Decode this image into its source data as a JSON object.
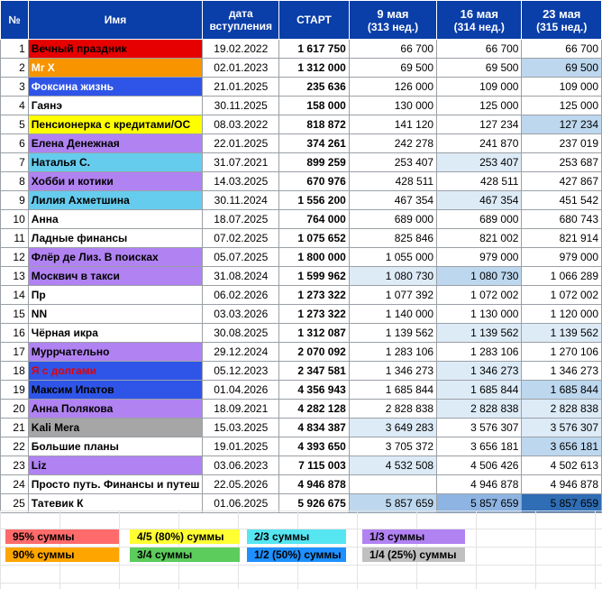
{
  "headers": {
    "idx": "№",
    "name": "Имя",
    "date": [
      "дата",
      "вступления"
    ],
    "start": "СТАРТ",
    "w1": [
      "9 мая",
      "(313 нед.)"
    ],
    "w2": [
      "16 мая",
      "(314 нед.)"
    ],
    "w3": [
      "23 мая",
      "(315 нед.)"
    ]
  },
  "rows": [
    {
      "n": "1",
      "name": "Вечный праздник",
      "date": "19.02.2022",
      "start": "1 617 750",
      "w1": "66 700",
      "w2": "66 700",
      "w3": "66 700",
      "name_bg": "#e60000",
      "name_color": "#000000",
      "w1_bg": "",
      "w2_bg": "",
      "w3_bg": ""
    },
    {
      "n": "2",
      "name": "Mr X",
      "date": "02.01.2023",
      "start": "1 312 000",
      "w1": "69 500",
      "w2": "69 500",
      "w3": "69 500",
      "name_bg": "#f79400",
      "name_color": "#ffffff",
      "w1_bg": "",
      "w2_bg": "",
      "w3_bg": "#bdd7ee"
    },
    {
      "n": "3",
      "name": "Фоксина жизнь",
      "date": "21.01.2025",
      "start": "235 636",
      "w1": "126 000",
      "w2": "109 000",
      "w3": "109 000",
      "name_bg": "#2f55e8",
      "name_color": "#ffffff",
      "w1_bg": "",
      "w2_bg": "",
      "w3_bg": ""
    },
    {
      "n": "4",
      "name": "Гаянэ",
      "date": "30.11.2025",
      "start": "158 000",
      "w1": "130 000",
      "w2": "125 000",
      "w3": "125 000",
      "name_bg": "",
      "name_color": "#000000",
      "w1_bg": "",
      "w2_bg": "",
      "w3_bg": ""
    },
    {
      "n": "5",
      "name": "Пенсионерка с кредитами/ОС",
      "date": "08.03.2022",
      "start": "818 872",
      "w1": "141 120",
      "w2": "127 234",
      "w3": "127 234",
      "name_bg": "#ffff00",
      "name_color": "#000000",
      "w1_bg": "",
      "w2_bg": "",
      "w3_bg": "#bdd7ee"
    },
    {
      "n": "6",
      "name": "Елена Денежная",
      "date": "22.01.2025",
      "start": "374 261",
      "w1": "242 278",
      "w2": "241 870",
      "w3": "237 019",
      "name_bg": "#b182f2",
      "name_color": "#000000",
      "w1_bg": "",
      "w2_bg": "",
      "w3_bg": ""
    },
    {
      "n": "7",
      "name": "Наталья С.",
      "date": "31.07.2021",
      "start": "899 259",
      "w1": "253 407",
      "w2": "253 407",
      "w3": "253 687",
      "name_bg": "#66ccee",
      "name_color": "#000000",
      "w1_bg": "",
      "w2_bg": "#ddebf7",
      "w3_bg": ""
    },
    {
      "n": "8",
      "name": "Хобби и котики",
      "date": "14.03.2025",
      "start": "670 976",
      "w1": "428 511",
      "w2": "428 511",
      "w3": "427 867",
      "name_bg": "#b182f2",
      "name_color": "#000000",
      "w1_bg": "",
      "w2_bg": "",
      "w3_bg": ""
    },
    {
      "n": "9",
      "name": "Лилия Ахметшина",
      "date": "30.11.2024",
      "start": "1 556 200",
      "w1": "467 354",
      "w2": "467 354",
      "w3": "451 542",
      "name_bg": "#66ccee",
      "name_color": "#000000",
      "w1_bg": "",
      "w2_bg": "#ddebf7",
      "w3_bg": ""
    },
    {
      "n": "10",
      "name": "Анна",
      "date": "18.07.2025",
      "start": "764 000",
      "w1": "689 000",
      "w2": "689 000",
      "w3": "680 743",
      "name_bg": "",
      "name_color": "#000000",
      "w1_bg": "",
      "w2_bg": "",
      "w3_bg": ""
    },
    {
      "n": "11",
      "name": "Ладные финансы",
      "date": "07.02.2025",
      "start": "1 075 652",
      "w1": "825 846",
      "w2": "821 002",
      "w3": "821 914",
      "name_bg": "",
      "name_color": "#000000",
      "w1_bg": "",
      "w2_bg": "",
      "w3_bg": ""
    },
    {
      "n": "12",
      "name": "Флёр де Лиз. В поисках",
      "date": "05.07.2025",
      "start": "1 800 000",
      "w1": "1 055 000",
      "w2": "979 000",
      "w3": "979 000",
      "name_bg": "#b182f2",
      "name_color": "#000000",
      "w1_bg": "",
      "w2_bg": "",
      "w3_bg": ""
    },
    {
      "n": "13",
      "name": "Москвич в такси",
      "date": "31.08.2024",
      "start": "1 599 962",
      "w1": "1 080 730",
      "w2": "1 080 730",
      "w3": "1 066 289",
      "name_bg": "#b182f2",
      "name_color": "#000000",
      "w1_bg": "#ddebf7",
      "w2_bg": "#bdd7ee",
      "w3_bg": ""
    },
    {
      "n": "14",
      "name": "Пр",
      "date": "06.02.2026",
      "start": "1 273 322",
      "w1": "1 077 392",
      "w2": "1 072 002",
      "w3": "1 072 002",
      "name_bg": "",
      "name_color": "#000000",
      "w1_bg": "",
      "w2_bg": "",
      "w3_bg": ""
    },
    {
      "n": "15",
      "name": "NN",
      "date": "03.03.2026",
      "start": "1 273 322",
      "w1": "1 140 000",
      "w2": "1 130 000",
      "w3": "1 120 000",
      "name_bg": "",
      "name_color": "#000000",
      "w1_bg": "",
      "w2_bg": "",
      "w3_bg": ""
    },
    {
      "n": "16",
      "name": "Чёрная икра",
      "date": "30.08.2025",
      "start": "1 312 087",
      "w1": "1 139 562",
      "w2": "1 139 562",
      "w3": "1 139 562",
      "name_bg": "",
      "name_color": "#000000",
      "w1_bg": "",
      "w2_bg": "#ddebf7",
      "w3_bg": "#ddebf7"
    },
    {
      "n": "17",
      "name": "Муррчательно",
      "date": "29.12.2024",
      "start": "2 070 092",
      "w1": "1 283 106",
      "w2": "1 283 106",
      "w3": "1 270 106",
      "name_bg": "#b182f2",
      "name_color": "#000000",
      "w1_bg": "",
      "w2_bg": "",
      "w3_bg": ""
    },
    {
      "n": "18",
      "name": "Я с долгами",
      "date": "05.12.2023",
      "start": "2 347 581",
      "w1": "1 346 273",
      "w2": "1 346 273",
      "w3": "1 346 273",
      "name_bg": "#2f55e8",
      "name_color": "#e60000",
      "w1_bg": "",
      "w2_bg": "#ddebf7",
      "w3_bg": ""
    },
    {
      "n": "19",
      "name": "Максим Ипатов",
      "date": "01.04.2026",
      "start": "4 356 943",
      "w1": "1 685 844",
      "w2": "1 685 844",
      "w3": "1 685 844",
      "name_bg": "#2f55e8",
      "name_color": "#000000",
      "w1_bg": "",
      "w2_bg": "#ddebf7",
      "w3_bg": "#bdd7ee"
    },
    {
      "n": "20",
      "name": "Анна Полякова",
      "date": "18.09.2021",
      "start": "4 282 128",
      "w1": "2 828 838",
      "w2": "2 828 838",
      "w3": "2 828 838",
      "name_bg": "#b182f2",
      "name_color": "#000000",
      "w1_bg": "",
      "w2_bg": "#ddebf7",
      "w3_bg": "#ddebf7"
    },
    {
      "n": "21",
      "name": "Kali Mera",
      "date": "15.03.2025",
      "start": "4 834 387",
      "w1": "3 649 283",
      "w2": "3 576 307",
      "w3": "3 576 307",
      "name_bg": "#a6a6a6",
      "name_color": "#000000",
      "w1_bg": "#ddebf7",
      "w2_bg": "",
      "w3_bg": "#ddebf7"
    },
    {
      "n": "22",
      "name": "Большие планы",
      "date": "19.01.2025",
      "start": "4 393 650",
      "w1": "3 705 372",
      "w2": "3 656 181",
      "w3": "3 656 181",
      "name_bg": "",
      "name_color": "#000000",
      "w1_bg": "",
      "w2_bg": "",
      "w3_bg": "#bdd7ee"
    },
    {
      "n": "23",
      "name": "Liz",
      "date": "03.06.2023",
      "start": "7 115 003",
      "w1": "4 532 508",
      "w2": "4 506 426",
      "w3": "4 502 613",
      "name_bg": "#b182f2",
      "name_color": "#000000",
      "w1_bg": "#ddebf7",
      "w2_bg": "",
      "w3_bg": ""
    },
    {
      "n": "24",
      "name": "Просто путь. Финансы и путеш",
      "date": "22.05.2026",
      "start": "4 946 878",
      "w1": "",
      "w2": "4 946 878",
      "w3": "4 946 878",
      "name_bg": "",
      "name_color": "#000000",
      "w1_bg": "",
      "w2_bg": "",
      "w3_bg": ""
    },
    {
      "n": "25",
      "name": "Татевик К",
      "date": "01.06.2025",
      "start": "5 926 675",
      "w1": "5 857 659",
      "w2": "5 857 659",
      "w3": "5 857 659",
      "name_bg": "",
      "name_color": "#000000",
      "w1_bg": "#bdd7ee",
      "w2_bg": "#8db4e2",
      "w3_bg": "#2f6db5"
    }
  ],
  "legend": [
    {
      "label": "95% суммы",
      "bg": "#ff6b6b"
    },
    {
      "label": "4/5 (80%) суммы",
      "bg": "#ffff33"
    },
    {
      "label": "2/3 суммы",
      "bg": "#55e6f2"
    },
    {
      "label": "1/3 суммы",
      "bg": "#b182f2"
    },
    {
      "label": "90% суммы",
      "bg": "#ffa500"
    },
    {
      "label": "3/4 суммы",
      "bg": "#5ccc5c"
    },
    {
      "label": "1/2 (50%) суммы",
      "bg": "#1e90ff"
    },
    {
      "label": "1/4 (25%) суммы",
      "bg": "#c0c0c0"
    }
  ]
}
